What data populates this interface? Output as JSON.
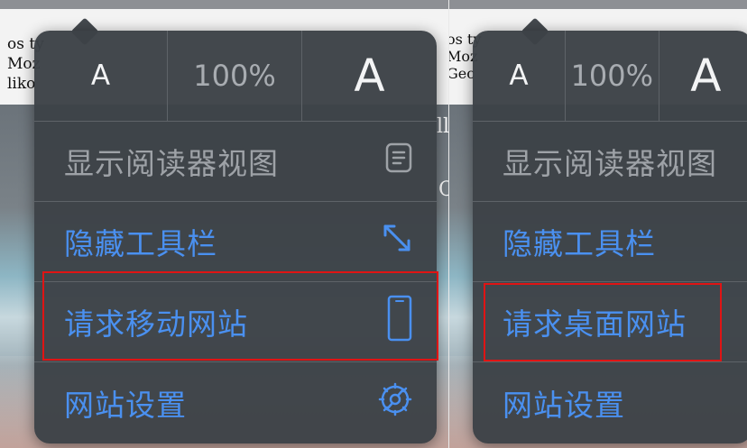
{
  "background": {
    "left_snippet": [
      "os ty",
      "Moz",
      "liko"
    ],
    "right_snippet": [
      "os ty",
      "Moz",
      "Gec"
    ],
    "right_edge_letter": "A"
  },
  "left_menu": {
    "font_controls": {
      "small_a": "A",
      "zoom": "100%",
      "large_a": "A"
    },
    "items": [
      {
        "label": "显示阅读器视图",
        "icon": "reader-view-icon"
      },
      {
        "label": "隐藏工具栏",
        "icon": "expand-arrows-icon"
      },
      {
        "label": "请求移动网站",
        "icon": "mobile-phone-icon"
      },
      {
        "label": "网站设置",
        "icon": "gear-icon"
      }
    ]
  },
  "right_menu": {
    "font_controls": {
      "small_a": "A",
      "zoom": "100%",
      "large_a": "A"
    },
    "items": [
      {
        "label": "显示阅读器视图"
      },
      {
        "label": "隐藏工具栏"
      },
      {
        "label": "请求桌面网站"
      },
      {
        "label": "网站设置"
      }
    ]
  },
  "colors": {
    "menu_background": "#3d4247",
    "action_blue": "#4a90f0",
    "disabled_gray": "#9ea2a7",
    "highlight_red": "#e01414"
  }
}
